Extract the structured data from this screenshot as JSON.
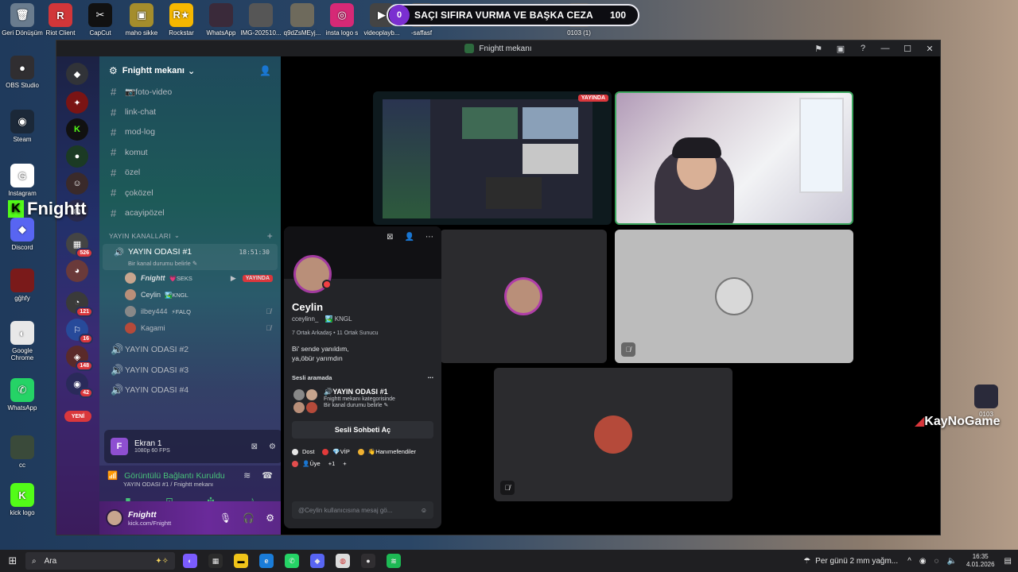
{
  "desktop": {
    "icons": [
      {
        "label": "Geri Dönüşüm",
        "glyph": "🗑",
        "color": "#6a7c8e"
      },
      {
        "label": "Riot Client",
        "glyph": "R",
        "color": "#d13639"
      },
      {
        "label": "CapCut",
        "glyph": "✂",
        "color": "#111"
      },
      {
        "label": "maho sikke",
        "glyph": "▣",
        "color": "#a48d2c"
      },
      {
        "label": "Rockstar",
        "glyph": "R★",
        "color": "#f5b700"
      },
      {
        "label": "WhatsApp",
        "glyph": "",
        "color": "#3a2a3a"
      },
      {
        "label": "IMG-202510...",
        "glyph": "",
        "color": "#565656"
      },
      {
        "label": "q9dZsMEyj...",
        "glyph": "",
        "color": "#6e6a5c"
      },
      {
        "label": "insta logo s",
        "glyph": "◎",
        "color": "#d62976"
      },
      {
        "label": "videoplayb...",
        "glyph": "▶",
        "color": "#444"
      },
      {
        "label": "-saffasf",
        "glyph": "",
        "color": "#555"
      },
      {
        "label": "0103 (1)",
        "glyph": "",
        "color": "#666"
      },
      {
        "label": "OBS Studio",
        "glyph": "●",
        "color": "#302e31"
      },
      {
        "label": "Steam",
        "glyph": "◉",
        "color": "#1b2838"
      },
      {
        "label": "Instagram",
        "glyph": "G",
        "color": "#fff"
      },
      {
        "label": "Discord",
        "glyph": "◆",
        "color": "#5865f2"
      },
      {
        "label": "gğhfy",
        "glyph": "",
        "color": "#7a1a1a"
      },
      {
        "label": "Google Chrome",
        "glyph": "◐",
        "color": "#e8e8e8"
      },
      {
        "label": "WhatsApp",
        "glyph": "✆",
        "color": "#25d366"
      },
      {
        "label": "cc",
        "glyph": "",
        "color": "#3a4a3a"
      },
      {
        "label": "kick logo",
        "glyph": "K",
        "color": "#53fc18"
      },
      {
        "label": "0103",
        "glyph": "",
        "color": "#2a2a3a"
      }
    ]
  },
  "overlay": {
    "counter": "0",
    "title": "SAÇI SIFIRA VURMA VE BAŞKA CEZA",
    "value": "100"
  },
  "window": {
    "title": "Fnightt mekanı"
  },
  "rail": {
    "badges": [
      "526",
      "121",
      "16",
      "148",
      "42"
    ],
    "new_label": "YENİ"
  },
  "server": {
    "name": "Fnightt mekanı",
    "channels": [
      "📷foto-video",
      "link-chat",
      "mod-log",
      "komut",
      "özel",
      "çoközel",
      "acayipözel"
    ],
    "category": "YAYIN KANALLARI",
    "active_voice": {
      "name": "YAYIN ODASI #1",
      "time": "18:51:30",
      "status": "Bir kanal durumu belirle"
    },
    "voice_users": [
      {
        "name": "Fnightt",
        "tag": "💗SEKS",
        "live": "YAYINDA",
        "avatar": "#c7a58e"
      },
      {
        "name": "Ceylin",
        "tag": "🏞️KNGL",
        "avatar": "#b98f79"
      },
      {
        "name": "ilbey444",
        "tag": "⚡FALQ",
        "avatar": "#888888"
      },
      {
        "name": "Kagami",
        "tag": "",
        "avatar": "#b54a3a"
      }
    ],
    "other_voice": [
      "YAYIN ODASI #2",
      "YAYIN ODASI #3",
      "YAYIN ODASI #4"
    ]
  },
  "stream_card": {
    "title": "Ekran 1",
    "sub": "1080p 60 FPS"
  },
  "voice_status": {
    "title": "Görüntülü Bağlantı Kuruldu",
    "sub": "YAYIN ODASI #1 / Fnightt mekanı"
  },
  "user_panel": {
    "name": "Fnightt",
    "status": "kick.com/Fnightt"
  },
  "stage": {
    "live_tag": "YAYINDA"
  },
  "profile": {
    "name": "Ceylin",
    "handle": "cceylinn_",
    "guild": "KNGL",
    "mutuals": "7 Ortak Arkadaş • 11 Ortak Sunucu",
    "bio_line1": "Bi' sende yanıldım,",
    "bio_line2": "ya,öbür yarımdın",
    "section": "Sesli aramada",
    "vc_name": "🔊YAYIN ODASI #1",
    "vc_sub": "Fnightt mekanı kategorisinde",
    "vc_status": "Bir kanal durumu belirle",
    "join_btn": "Sesli Sohbeti Aç",
    "roles": [
      {
        "label": "Dost",
        "color": "#e6e6e6"
      },
      {
        "label": "💎VİP",
        "color": "#e23a3a"
      },
      {
        "label": "👋Hanımefendiler",
        "color": "#f0b232"
      },
      {
        "label": "👤Üye",
        "color": "#e34d4d"
      }
    ],
    "roles_more": "+1",
    "message_placeholder": "@Ceylin kullanıcısına mesaj gö..."
  },
  "branding": {
    "fnightt": "Fnightt",
    "kaynogame": "KayNoGame"
  },
  "taskbar": {
    "search": "Ara",
    "weather": "Per günü 2 mm yağm...",
    "time": "16:35",
    "date": "4.01.2026"
  }
}
